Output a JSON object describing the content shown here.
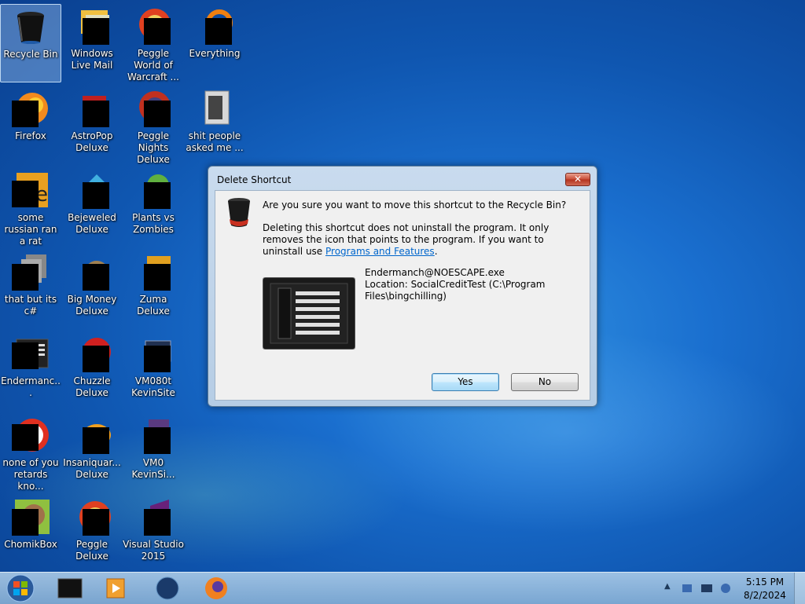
{
  "desktop": {
    "icons": [
      {
        "label": "Recycle Bin"
      },
      {
        "label": "Windows Live Mail"
      },
      {
        "label": "Peggle World of Warcraft ..."
      },
      {
        "label": "Everything"
      },
      {
        "label": "Firefox"
      },
      {
        "label": "AstroPop Deluxe"
      },
      {
        "label": "Peggle Nights Deluxe"
      },
      {
        "label": "shit people asked me ..."
      },
      {
        "label": "some russian ran a rat"
      },
      {
        "label": "Bejeweled Deluxe"
      },
      {
        "label": "Plants vs Zombies"
      },
      {
        "label": "that but its c#"
      },
      {
        "label": "Big Money Deluxe"
      },
      {
        "label": "Zuma Deluxe"
      },
      {
        "label": "Endermanc..."
      },
      {
        "label": "Chuzzle Deluxe"
      },
      {
        "label": "VM080t KevinSite"
      },
      {
        "label": "none of you retards kno..."
      },
      {
        "label": "Insaniquar... Deluxe"
      },
      {
        "label": "VM0 KevinSi..."
      },
      {
        "label": "ChomikBox"
      },
      {
        "label": "Peggle Deluxe"
      },
      {
        "label": "Visual Studio 2015"
      }
    ]
  },
  "dialog": {
    "title": "Delete Shortcut",
    "close_label": "✕",
    "question": "Are you sure you want to move this shortcut to the Recycle Bin?",
    "info_text": "Deleting this shortcut does not uninstall the program. It only removes the icon that points to the program. If you want to uninstall use ",
    "info_link": "Programs and Features",
    "info_end": ".",
    "file_name": "Endermanch@NOESCAPE.exe",
    "file_location": "Location: SocialCreditTest (C:\\Program Files\\bingchilling)",
    "yes_label": "Yes",
    "no_label": "No"
  },
  "taskbar": {
    "time": "5:15 PM",
    "date": "8/2/2024",
    "tray_arrow": "▲"
  },
  "colors": {
    "accent": "#1a6fcf",
    "link": "#0066cc",
    "close": "#c84a35"
  }
}
